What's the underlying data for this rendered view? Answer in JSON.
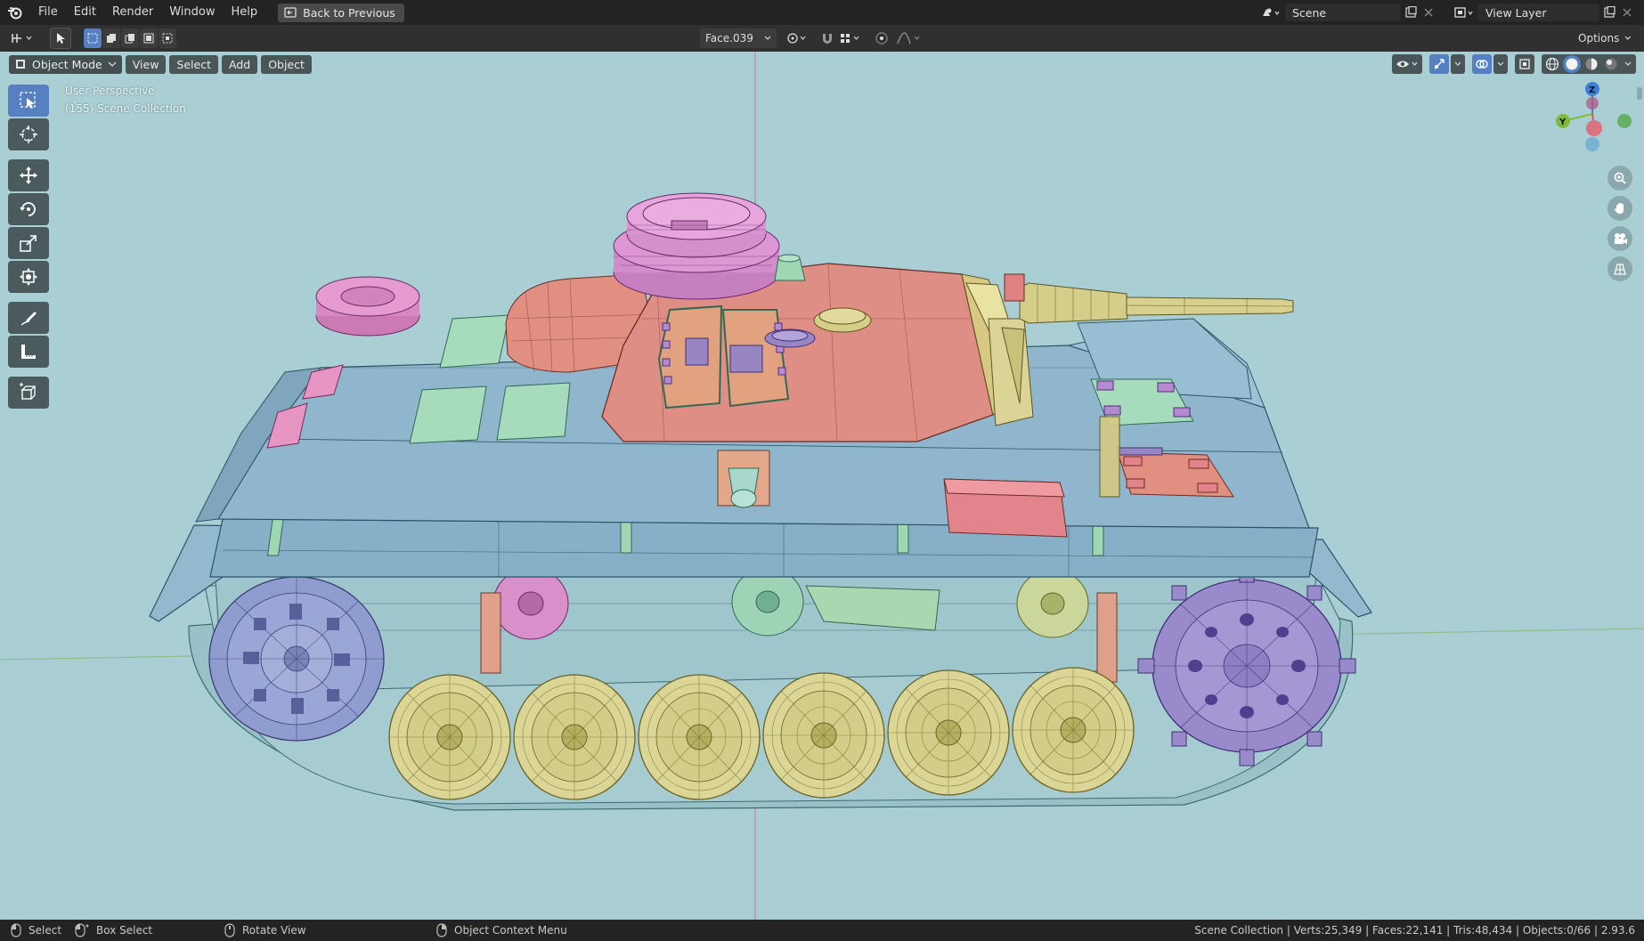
{
  "app": {
    "name": "Blender"
  },
  "menu": {
    "items": [
      "File",
      "Edit",
      "Render",
      "Window",
      "Help"
    ],
    "back_label": "Back to Previous"
  },
  "scene": {
    "label": "Scene",
    "view_layer": "View Layer"
  },
  "toolbar": {
    "face_select": "Face.039",
    "options": "Options"
  },
  "viewport": {
    "mode": "Object Mode",
    "menus": [
      "View",
      "Select",
      "Add",
      "Object"
    ],
    "perspective": "User Perspective",
    "collection": "(155) Scene Collection",
    "axes": {
      "z": "Z",
      "y": "Y"
    }
  },
  "status": {
    "select": "Select",
    "box_select": "Box Select",
    "rotate": "Rotate View",
    "context_menu": "Object Context Menu",
    "stats": "Scene Collection | Verts:25,349 | Faces:22,141 | Tris:48,434 | Objects:0/66 | 2.93.6"
  },
  "colors": {
    "viewport_bg": "#a9cfd5",
    "hull": "#8cb3cb",
    "turret": "#dd8d86",
    "hatch_pink": "#e796c4",
    "hatch_green": "#9fd7b5",
    "wheel_yellow": "#dcd79a",
    "sprocket_purple": "#9b8fcf",
    "idler_blue": "#93a0cf",
    "track": "#a8c9ce",
    "active_tool": "#5680c2"
  },
  "icons": {
    "tools": [
      "select-box-icon",
      "cursor-icon",
      "move-icon",
      "rotate-icon",
      "scale-icon",
      "transform-icon",
      "annotate-icon",
      "measure-icon",
      "add-cube-icon"
    ],
    "nav": [
      "zoom-icon",
      "pan-hand-icon",
      "camera-icon",
      "grid-ortho-icon"
    ]
  }
}
